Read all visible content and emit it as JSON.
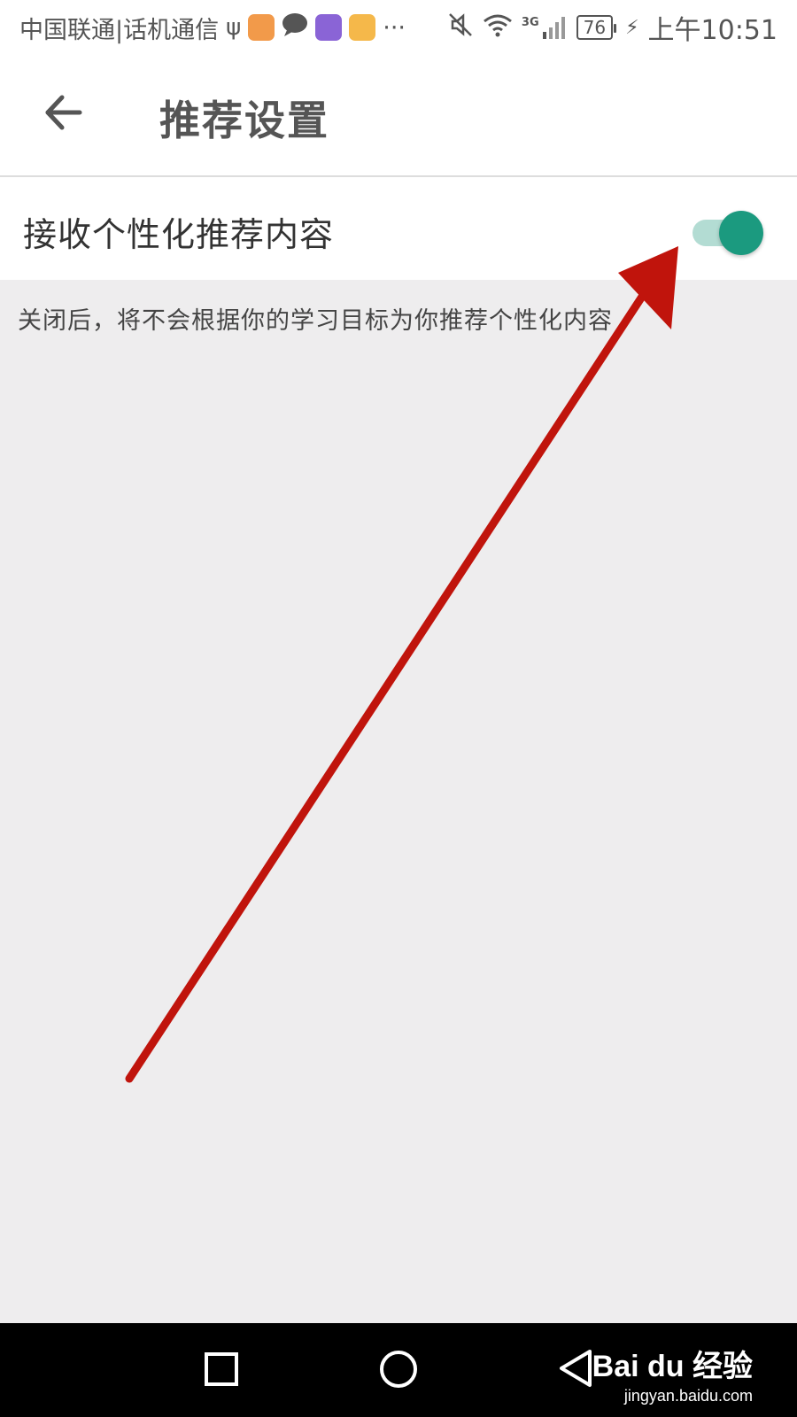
{
  "status_bar": {
    "carrier": "中国联通|话机通信",
    "overflow": "···",
    "network": "3G",
    "battery": "76",
    "time": "上午10:51"
  },
  "header": {
    "title": "推荐设置"
  },
  "settings": {
    "personalized_label": "接收个性化推荐内容",
    "personalized_enabled": true,
    "description": "关闭后，将不会根据你的学习目标为你推荐个性化内容"
  },
  "colors": {
    "accent": "#1b9a7f",
    "accent_track": "#b3dcd3",
    "annotation_arrow": "#c0140c",
    "background": "#eeedee"
  },
  "watermark": {
    "logo": "Bai du 经验",
    "url": "jingyan.baidu.com"
  }
}
